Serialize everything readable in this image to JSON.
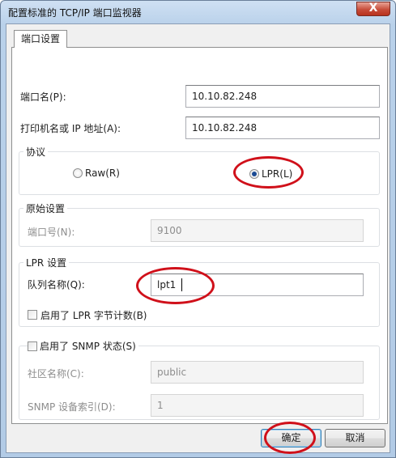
{
  "window": {
    "title": "配置标准的 TCP/IP 端口监视器",
    "close_label": "X"
  },
  "tab": {
    "label": "端口设置"
  },
  "port_name": {
    "label": "端口名(P):",
    "value": "10.10.82.248"
  },
  "printer_name": {
    "label": "打印机名或 IP 地址(A):",
    "value": "10.10.82.248"
  },
  "protocol": {
    "title": "协议",
    "raw_label": "Raw(R)",
    "lpr_label": "LPR(L)",
    "selected": "LPR"
  },
  "raw_settings": {
    "title": "原始设置",
    "port_number_label": "端口号(N):",
    "port_number_value": "9100"
  },
  "lpr_settings": {
    "title": "LPR 设置",
    "queue_label": "队列名称(Q):",
    "queue_value": "lpt1",
    "byte_count_label": "启用了 LPR 字节计数(B)",
    "byte_count_checked": false
  },
  "snmp": {
    "enable_label": "启用了 SNMP 状态(S)",
    "enabled": false,
    "community_label": "社区名称(C):",
    "community_value": "public",
    "device_index_label": "SNMP 设备索引(D):",
    "device_index_value": "1"
  },
  "buttons": {
    "ok": "确定",
    "cancel": "取消"
  },
  "annotation_color": "#d0101a"
}
